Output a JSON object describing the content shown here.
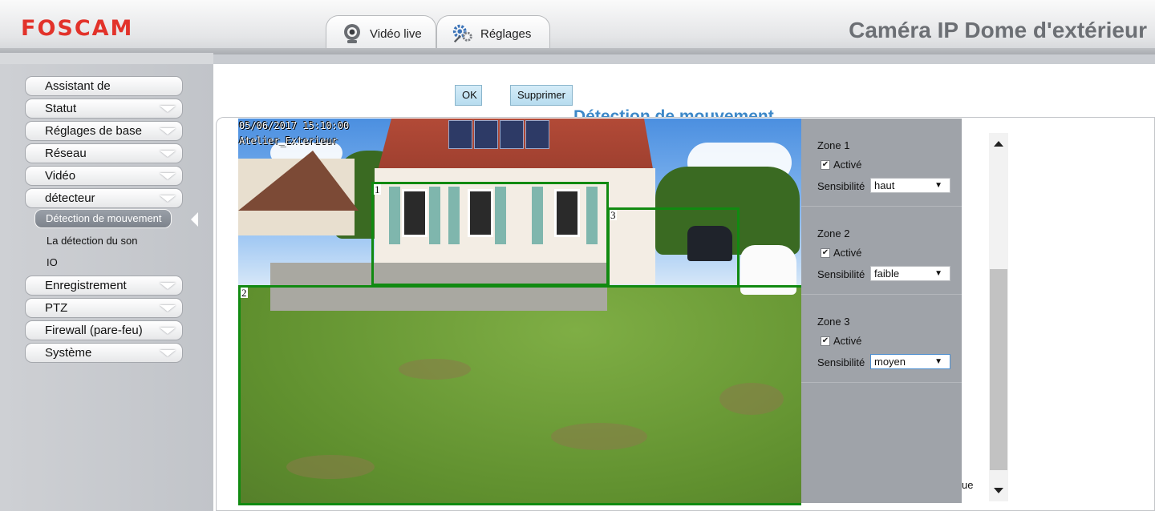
{
  "header": {
    "logo": "FOSCAM",
    "title": "Caméra IP Dome d'extérieur",
    "tabs": [
      {
        "label": "Vidéo live",
        "icon": "webcam-icon"
      },
      {
        "label": "Réglages",
        "icon": "gears-icon"
      }
    ]
  },
  "sidebar": {
    "items": [
      {
        "label": "Assistant de configuration"
      },
      {
        "label": "Statut"
      },
      {
        "label": "Réglages de base"
      },
      {
        "label": "Réseau"
      },
      {
        "label": "Vidéo"
      },
      {
        "label": "détecteur"
      },
      {
        "label": "Enregistrement"
      },
      {
        "label": "PTZ"
      },
      {
        "label": "Firewall (pare-feu)"
      },
      {
        "label": "Système"
      }
    ],
    "sub_items": [
      {
        "label": "Détection de mouvement",
        "active": true
      },
      {
        "label": "La détection du son"
      },
      {
        "label": "IO"
      }
    ]
  },
  "toolbar": {
    "ok_label": "OK",
    "delete_label": "Supprimer"
  },
  "page": {
    "section_title": "Détection de mouvement",
    "partial_text": "ue"
  },
  "camera": {
    "osd_datetime": "05/06/2017 15:10:00",
    "osd_name": "Atelier_Exterieur",
    "zone_labels": [
      "1",
      "2",
      "3"
    ],
    "zone_color": "#118a11"
  },
  "zones": [
    {
      "title": "Zone 1",
      "enabled_label": "Activé",
      "enabled": true,
      "sensitivity_label": "Sensibilité",
      "sensitivity": "haut"
    },
    {
      "title": "Zone 2",
      "enabled_label": "Activé",
      "enabled": true,
      "sensitivity_label": "Sensibilité",
      "sensitivity": "faible"
    },
    {
      "title": "Zone 3",
      "enabled_label": "Activé",
      "enabled": true,
      "sensitivity_label": "Sensibilité",
      "sensitivity": "moyen"
    }
  ],
  "colors": {
    "brand": "#e2322a",
    "title_blue": "#3d88c8",
    "button_blue": "#c4e3f3"
  }
}
